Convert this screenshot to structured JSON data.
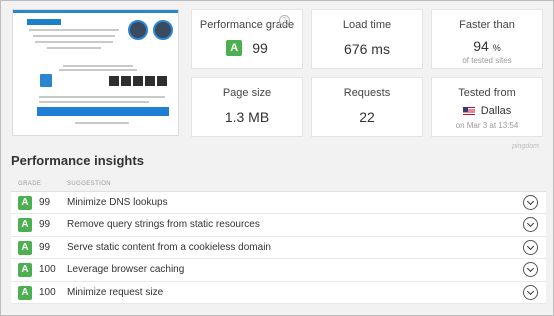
{
  "metrics": {
    "grade": {
      "label": "Performance grade",
      "letter": "A",
      "value": "99",
      "help": "?"
    },
    "load_time": {
      "label": "Load time",
      "value": "676 ms"
    },
    "faster_than": {
      "label": "Faster than",
      "value": "94",
      "unit": "%",
      "sub": "of tested sites"
    },
    "page_size": {
      "label": "Page size",
      "value": "1.3 MB"
    },
    "requests": {
      "label": "Requests",
      "value": "22"
    },
    "tested_from": {
      "label": "Tested from",
      "location": "Dallas",
      "date": "on Mar 3 at 13:54"
    }
  },
  "brand": "pingdom",
  "insights": {
    "title": "Performance insights",
    "columns": {
      "grade": "GRADE",
      "suggestion": "SUGGESTION"
    },
    "rows": [
      {
        "letter": "A",
        "score": "99",
        "suggestion": "Minimize DNS lookups"
      },
      {
        "letter": "A",
        "score": "99",
        "suggestion": "Remove query strings from static resources"
      },
      {
        "letter": "A",
        "score": "99",
        "suggestion": "Serve static content from a cookieless domain"
      },
      {
        "letter": "A",
        "score": "100",
        "suggestion": "Leverage browser caching"
      },
      {
        "letter": "A",
        "score": "100",
        "suggestion": "Minimize request size"
      }
    ]
  },
  "colors": {
    "grade_a": "#4caf50",
    "accent": "#2a86d1"
  },
  "icons": {
    "help": "help-circle-icon",
    "flag": "us-flag-icon",
    "expand": "chevron-down-icon"
  }
}
